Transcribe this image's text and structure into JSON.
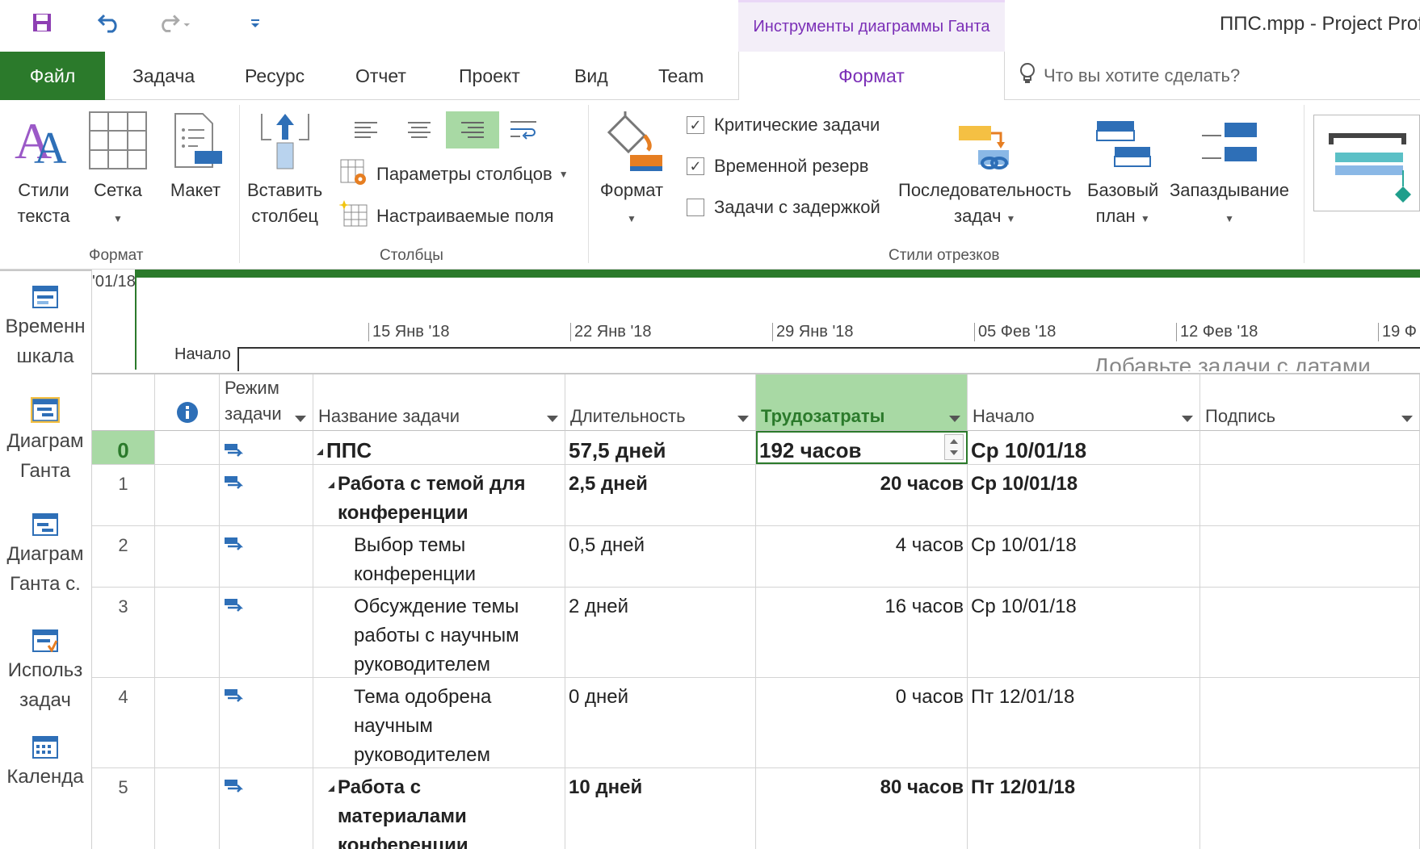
{
  "window": {
    "title": "ППС.mpp  -  Project Prof"
  },
  "context_tab": {
    "header": "Инструменты диаграммы Ганта",
    "tab": "Формат"
  },
  "tabs": [
    "Файл",
    "Задача",
    "Ресурс",
    "Отчет",
    "Проект",
    "Вид",
    "Team"
  ],
  "tellme": {
    "placeholder": "Что вы хотите сделать?"
  },
  "ribbon": {
    "format_group": {
      "label": "Формат",
      "text_styles": [
        "Стили",
        "текста"
      ],
      "gridlines": "Сетка",
      "layout": "Макет"
    },
    "columns_group": {
      "label": "Столбцы",
      "insert_column": [
        "Вставить",
        "столбец"
      ],
      "column_settings": "Параметры столбцов",
      "custom_fields": "Настраиваемые поля"
    },
    "bar_styles_group": {
      "label": "Стили отрезков",
      "format": "Формат",
      "critical_tasks": "Критические задачи",
      "slack": "Временной резерв",
      "late_tasks": "Задачи с задержкой",
      "task_path": [
        "Последовательность",
        "задач"
      ],
      "baseline": [
        "Базовый",
        "план"
      ],
      "slippage": "Запаздывание"
    },
    "checks": {
      "critical": true,
      "slack": true,
      "late": false
    }
  },
  "viewbar": {
    "items": [
      [
        "Временн",
        "шкала"
      ],
      [
        "Диаграм",
        "Ганта"
      ],
      [
        "Диаграм",
        "Ганта с."
      ],
      [
        "Использ",
        "задач"
      ],
      [
        "",
        "Календа"
      ]
    ]
  },
  "timeline": {
    "left_date": "'01/18",
    "ticks": [
      "15 Янв '18",
      "22 Янв '18",
      "29 Янв '18",
      "05 Фев '18",
      "12 Фев '18",
      "19 Ф"
    ],
    "start_label": "Начало",
    "hint": "Добавьте задачи с датами"
  },
  "grid": {
    "headers": {
      "mode": [
        "Режим",
        "задачи"
      ],
      "name": "Название задачи",
      "duration": "Длительность",
      "work": "Трудозатраты",
      "start": "Начало",
      "label": "Подпись"
    },
    "rows": [
      {
        "id": "0",
        "name": "ППС",
        "duration": "57,5 дней",
        "work": "192 часов",
        "start": "Ср 10/01/18",
        "summary": true
      },
      {
        "id": "1",
        "name_lines": [
          "Работа с темой для",
          "конференции"
        ],
        "duration": "2,5 дней",
        "work": "20 часов",
        "start": "Ср 10/01/18",
        "summary": true
      },
      {
        "id": "2",
        "name_lines": [
          "Выбор темы",
          "конференции"
        ],
        "duration": "0,5 дней",
        "work": "4 часов",
        "start": "Ср 10/01/18",
        "summary": false
      },
      {
        "id": "3",
        "name_lines": [
          "Обсуждение темы",
          "работы с научным",
          "руководителем"
        ],
        "duration": "2 дней",
        "work": "16 часов",
        "start": "Ср 10/01/18",
        "summary": false
      },
      {
        "id": "4",
        "name_lines": [
          "Тема одобрена",
          "научным",
          "руководителем"
        ],
        "duration": "0 дней",
        "work": "0 часов",
        "start": "Пт 12/01/18",
        "summary": false
      },
      {
        "id": "5",
        "name_lines": [
          "Работа с",
          "материалами",
          "конференции"
        ],
        "duration": "10 дней",
        "work": "80 часов",
        "start": "Пт 12/01/18",
        "summary": true
      }
    ]
  },
  "colors": {
    "accent": "#2b7a2b",
    "context": "#7b2fb7",
    "selected": "#a8d9a4"
  }
}
